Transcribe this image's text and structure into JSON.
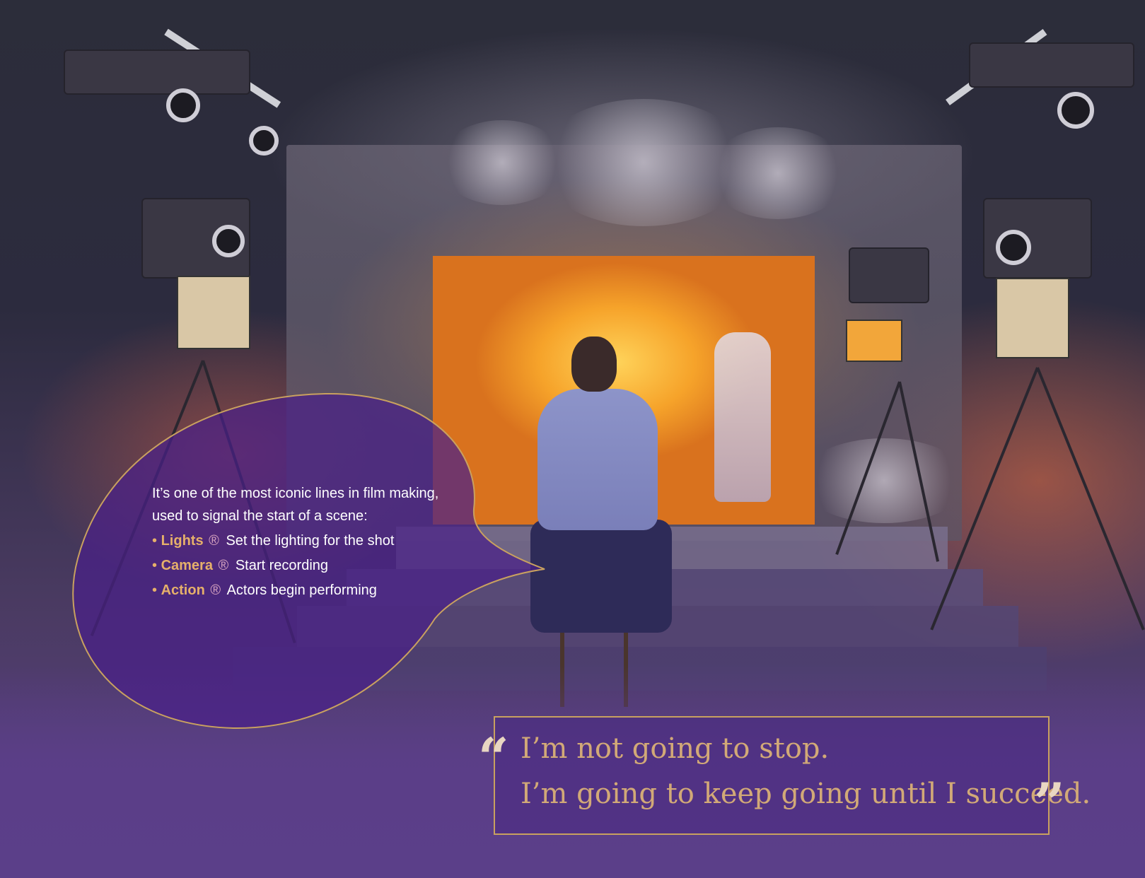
{
  "bubble": {
    "intro": "It’s one of the most iconic lines in film making, used to signal the start of a scene:",
    "items": [
      {
        "bullet": "•",
        "term": "Lights",
        "mark": "®",
        "desc": "Set the lighting for the shot"
      },
      {
        "bullet": "•",
        "term": "Camera",
        "mark": "®",
        "desc": "Start recording"
      },
      {
        "bullet": "•",
        "term": "Action",
        "mark": "®",
        "desc": "Actors begin performing"
      }
    ]
  },
  "quote": {
    "open_mark": "“",
    "line1": "I’m not going to stop.",
    "line2": "I’m going to keep going until I succeed.",
    "close_mark": "”"
  },
  "colors": {
    "accent_gold": "#e6b06a",
    "quote_text": "#d2a977",
    "bubble_outline": "#c9a15f",
    "bubble_fill": "#4a2088",
    "background_purple": "#5b3f89",
    "fire_orange": "#f6a32a"
  }
}
